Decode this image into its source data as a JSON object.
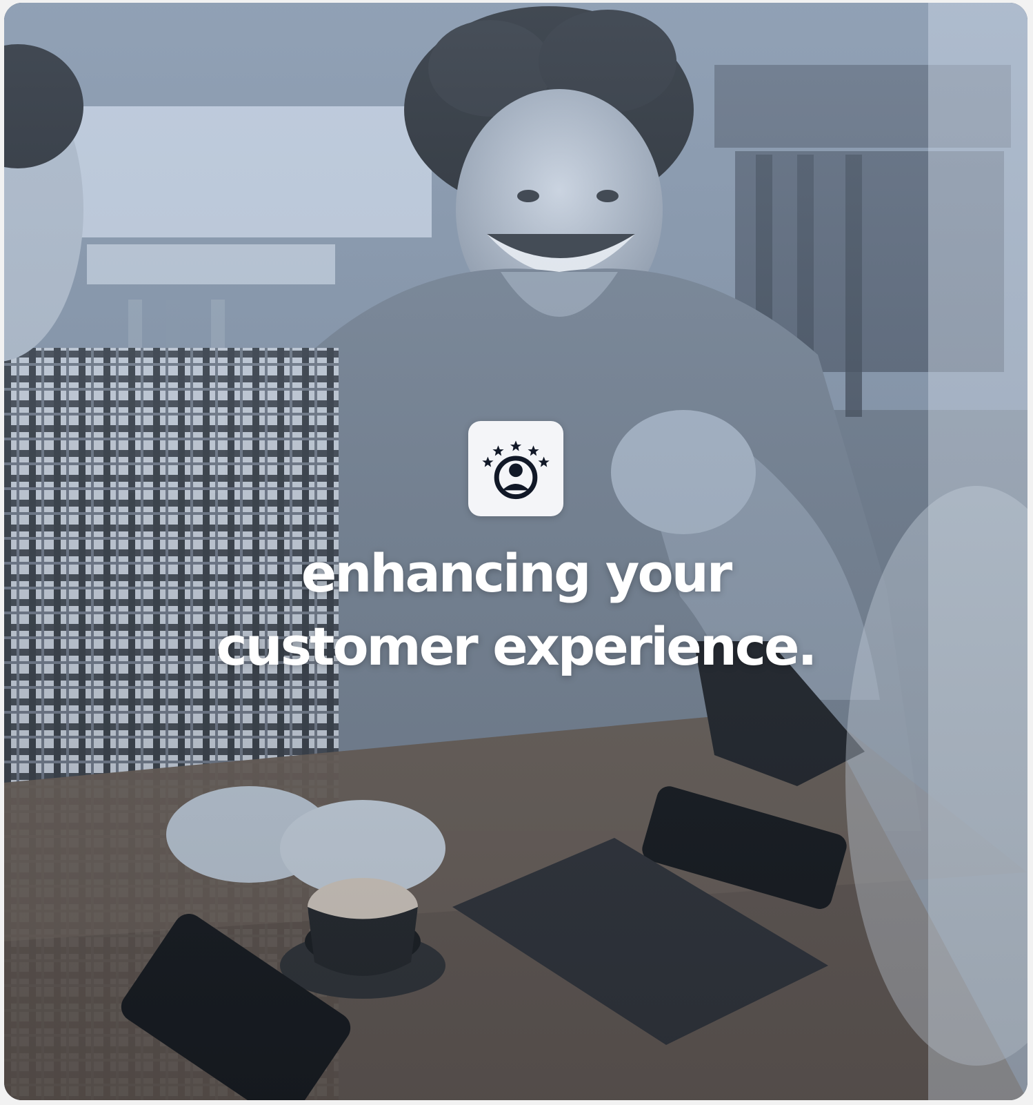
{
  "hero": {
    "icon": "customer-rating-icon",
    "headline": [
      "enhancing your",
      "customer experience."
    ]
  }
}
